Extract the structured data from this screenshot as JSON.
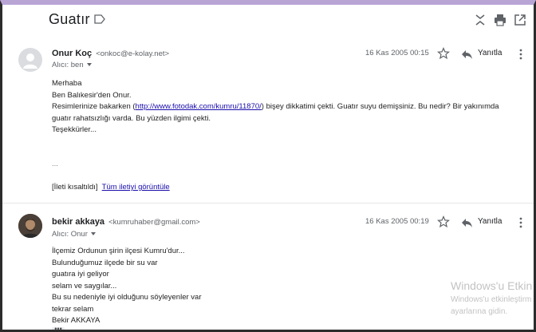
{
  "thread": {
    "subject": "Guatır"
  },
  "messages": [
    {
      "sender_name": "Onur Koç",
      "sender_email": "<onkoc@e-kolay.net>",
      "to_line": "Alıcı: ben",
      "date": "16 Kas 2005 00:15",
      "reply_label": "Yanıtla",
      "lines": {
        "l1": "Merhaba",
        "l2": "Ben Balıkesir'den Onur.",
        "l3a": "Resimlerinize bakarken (",
        "link": "http://www.fotodak.com/kumru/11870/",
        "l3b": ")  bişey dikkatimi çekti.   Guatır suyu demişsiniz. Bu nedir? Bir yakınımda",
        "l4": "guatır rahatsızlığı varda. Bu yüzden ilgimi çekti.",
        "l5": "Teşekkürler...",
        "ellipsis": "...",
        "clipped": "[İleti kısaltıldı]",
        "view_all": "Tüm iletiyi görüntüle"
      }
    },
    {
      "sender_name": "bekir akkaya",
      "sender_email": "<kumruhaber@gmail.com>",
      "to_line": "Alıcı: Onur",
      "date": "16 Kas 2005 00:19",
      "reply_label": "Yanıtla",
      "lines": {
        "l1": "İlçemiz Ordunun şirin ilçesi Kumru'dur...",
        "l2": "Bulunduğumuz ilçede bir su var",
        "l3": "guatıra iyi geliyor",
        "l4": "selam ve saygılar...",
        "l5": "Bu su nedeniyle iyi olduğunu söyleyenler var",
        "l6": "tekrar selam",
        "l7": "Bekir AKKAYA",
        "dots": "•••"
      }
    }
  ],
  "watermark": {
    "line1": "Windows'u Etkin",
    "line2": "Windows'u etkinleştirm",
    "line3": "ayarlarına gidin."
  },
  "icons": {
    "label": "label-icon",
    "collapse": "collapse-icon",
    "print": "print-icon",
    "open_new": "open-in-new-icon",
    "star": "star-icon",
    "reply": "reply-icon",
    "more": "more-vert-icon"
  }
}
